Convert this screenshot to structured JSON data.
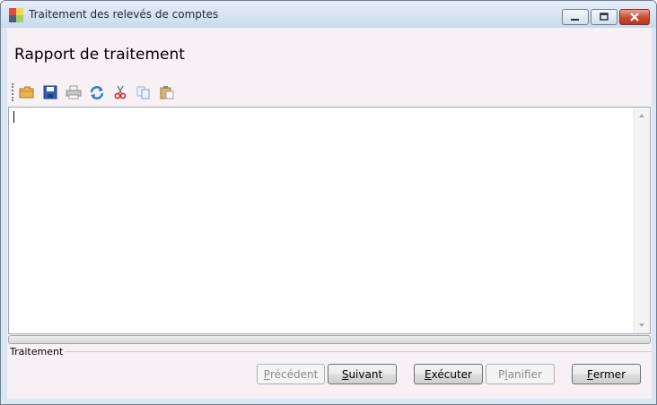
{
  "window": {
    "title": "Traitement des relevés de comptes",
    "icon": "app-colored-squares-icon",
    "controls": [
      "minimize-icon",
      "maximize-icon",
      "close-icon"
    ]
  },
  "heading": "Rapport de traitement",
  "toolbar": {
    "items": [
      "open-folder-icon",
      "save-icon",
      "print-icon",
      "refresh-icon",
      "cut-icon",
      "copy-icon",
      "paste-icon"
    ]
  },
  "editor": {
    "value": ""
  },
  "progress": {
    "value": 0
  },
  "group": {
    "label": "Traitement"
  },
  "buttons": {
    "previous": {
      "mnemonic": "P",
      "rest": "récédent",
      "enabled": false
    },
    "next": {
      "mnemonic": "S",
      "rest": "uivant",
      "enabled": true
    },
    "execute": {
      "mnemonic": "E",
      "rest": "xécuter",
      "enabled": true
    },
    "schedule": {
      "mnemonic": "l",
      "pre": "P",
      "rest": "anifier",
      "enabled": false
    },
    "close": {
      "mnemonic": "F",
      "rest": "ermer",
      "enabled": true
    }
  },
  "colors": {
    "accent": "#c94b32",
    "client_bg": "#f7f1f5",
    "frame": "#dbe7f5"
  }
}
